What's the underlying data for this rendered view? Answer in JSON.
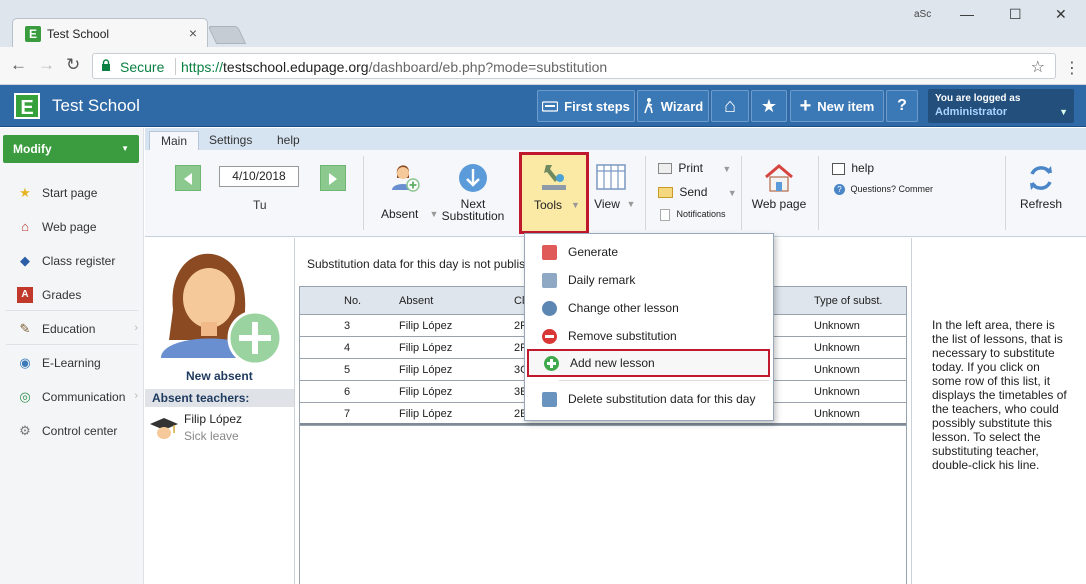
{
  "browser": {
    "tab_title": "Test School",
    "tab_close": "×",
    "incognito_label": "aSc",
    "window_controls": {
      "minimize": "—",
      "maximize": "☐",
      "close": "✕"
    },
    "nav": {
      "back": "←",
      "forward": "→",
      "reload": "↻"
    },
    "secure_label": "Secure",
    "url_scheme": "https://",
    "url_host": "testschool.edupage.org",
    "url_path": "/dashboard/eb.php?mode=substitution",
    "bookmark": "☆",
    "menu": "⋮"
  },
  "header": {
    "app_title": "Test School",
    "logo_letter": "E",
    "buttons": {
      "first_steps": "First steps",
      "wizard": "Wizard",
      "home": "⌂",
      "favorites": "★",
      "new_item": "New item",
      "help": "?"
    },
    "user_line1": "You are logged as",
    "user_line2": "Administrator",
    "user_dropdown": "▼"
  },
  "sidebar": {
    "modify_label": "Modify",
    "modify_dropdown": "▼",
    "items": [
      {
        "label": "Start page",
        "icon": "★",
        "icon_color": "#e6b422",
        "arrow": ""
      },
      {
        "label": "Web page",
        "icon": "⌂",
        "icon_color": "#c0392b",
        "arrow": ""
      },
      {
        "label": "Class register",
        "icon": "◆",
        "icon_color": "#2c5ea8",
        "arrow": ""
      },
      {
        "label": "Grades",
        "icon": "A",
        "icon_color": "#c0392b",
        "arrow": ""
      },
      {
        "label": "Education",
        "icon": "✎",
        "icon_color": "#7a5c2e",
        "arrow": "›"
      },
      {
        "label": "E-Learning",
        "icon": "◉",
        "icon_color": "#3a7bb8",
        "arrow": ""
      },
      {
        "label": "Communication",
        "icon": "◎",
        "icon_color": "#2f8f4e",
        "arrow": "›"
      },
      {
        "label": "Control center",
        "icon": "⚙",
        "icon_color": "#777777",
        "arrow": ""
      }
    ]
  },
  "ribbon": {
    "tabs": [
      "Main",
      "Settings",
      "help"
    ],
    "date": "4/10/2018",
    "day": "Tu",
    "absent_label": "Absent",
    "next_substitution_line1": "Next",
    "next_substitution_line2": "Substitution",
    "tools_label": "Tools",
    "view_label": "View",
    "print_label": "Print",
    "send_label": "Send",
    "notifications_label": "Notifications",
    "web_page_label": "Web page",
    "help_label": "help",
    "questions_label": "Questions? Commer",
    "refresh_label": "Refresh",
    "dropdown_arrow": "▼"
  },
  "absent_panel": {
    "new_absent_label": "New absent",
    "section_title": "Absent teachers:",
    "teacher_name": "Filip López",
    "teacher_status": "Sick leave"
  },
  "main": {
    "notice": "Substitution data for this day is not publis",
    "table": {
      "headers": {
        "no": "No.",
        "absent": "Absent",
        "col3": "Cl",
        "type": "Type of subst."
      },
      "rows": [
        {
          "no": "3",
          "absent": "Filip López",
          "col3": "2F",
          "type": "Unknown"
        },
        {
          "no": "4",
          "absent": "Filip López",
          "col3": "2F",
          "type": "Unknown"
        },
        {
          "no": "5",
          "absent": "Filip López",
          "col3": "3C",
          "type": "Unknown"
        },
        {
          "no": "6",
          "absent": "Filip López",
          "col3": "3E",
          "type": "Unknown"
        },
        {
          "no": "7",
          "absent": "Filip López",
          "col3": "2E",
          "type": "Unknown"
        }
      ]
    }
  },
  "help_panel": {
    "text": "In the left area, there is the list of lessons, that is necessary to substitute today. If you click on some row of this list, it displays the timetables of the teachers, who could possibly substitute this lesson. To select the substituting teacher, double-click his line."
  },
  "tools_menu": {
    "items": [
      {
        "label": "Generate",
        "icon_color": "#e05a5a"
      },
      {
        "label": "Daily remark",
        "icon_color": "#8fa9c4"
      },
      {
        "label": "Change other lesson",
        "icon_color": "#5d87b3"
      },
      {
        "label": "Remove substitution",
        "icon_color": "#d93636"
      },
      {
        "label": "Add new lesson",
        "icon_color": "#3ea84a"
      },
      {
        "label": "Delete substitution data for this day",
        "icon_color": "#6a94c0"
      }
    ],
    "highlight_color": "#c0182c"
  }
}
